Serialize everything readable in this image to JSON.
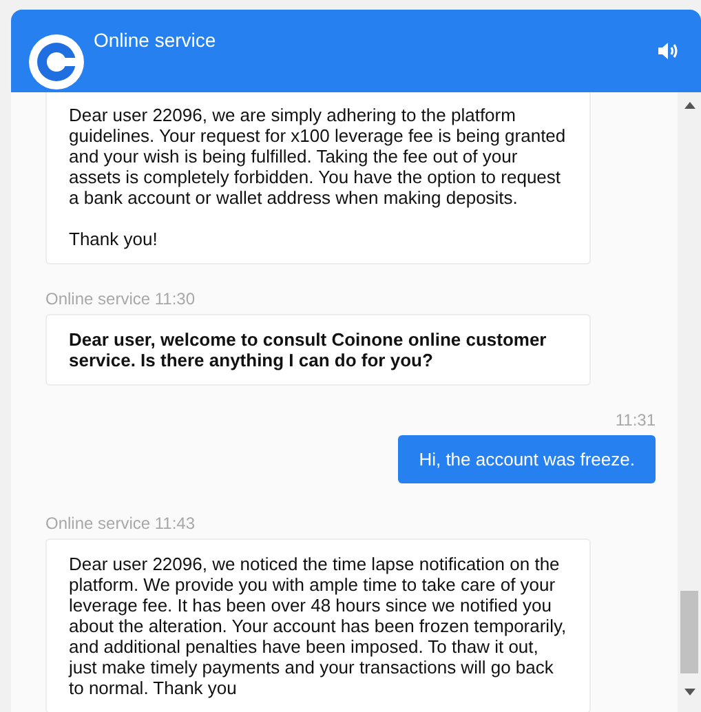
{
  "window": {
    "title": "Online service"
  },
  "messages": [
    {
      "kind": "agent",
      "text": "Dear user 22096, we are simply adhering to the platform guidelines. Your request for x100 leverage fee is being granted and your wish is being fulfilled. Taking the fee out of your assets is completely forbidden. You have the option to request a bank account or wallet address when making deposits.\n\nThank you!",
      "bold": false
    },
    {
      "kind": "agent",
      "meta": "Online service 11:30",
      "text": "Dear user, welcome to consult Coinone online customer service. Is there anything I can do for you?",
      "bold": true
    },
    {
      "kind": "user",
      "meta": "11:31",
      "text": "Hi, the account was freeze.",
      "bold": false
    },
    {
      "kind": "agent",
      "meta": "Online service 11:43",
      "text": "Dear user 22096, we noticed the time lapse notification on the platform. We provide you with ample time to take care of your leverage fee. It has been over 48 hours since we notified you about the alteration. Your account has been frozen temporarily, and additional penalties have been imposed. To thaw it out, just make timely payments and your transactions will go back to normal. Thank you",
      "bold": false
    }
  ]
}
